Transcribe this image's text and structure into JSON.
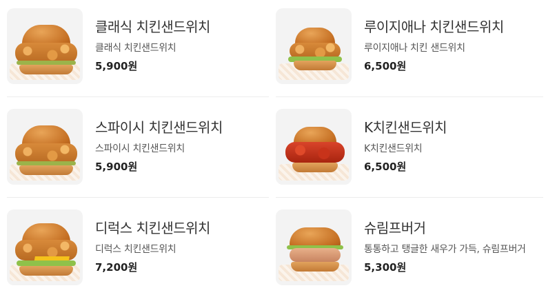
{
  "menu": {
    "items": [
      {
        "title": "클래식 치킨샌드위치",
        "desc": "클래식 치킨샌드위치",
        "price": "5,900원",
        "variant": "classic"
      },
      {
        "title": "루이지애나 치킨샌드위치",
        "desc": "루이지애나 치킨 샌드위치",
        "price": "6,500원",
        "variant": "classic"
      },
      {
        "title": "스파이시 치킨샌드위치",
        "desc": "스파이시 치킨샌드위치",
        "price": "5,900원",
        "variant": "classic"
      },
      {
        "title": "K치킨샌드위치",
        "desc": "K치킨샌드위치",
        "price": "6,500원",
        "variant": "spicy"
      },
      {
        "title": "디럭스 치킨샌드위치",
        "desc": "디럭스 치킨샌드위치",
        "price": "7,200원",
        "variant": "deluxe"
      },
      {
        "title": "슈림프버거",
        "desc": "통통하고 탱글한 새우가 가득, 슈림프버거",
        "price": "5,300원",
        "variant": "shrimp"
      }
    ]
  }
}
